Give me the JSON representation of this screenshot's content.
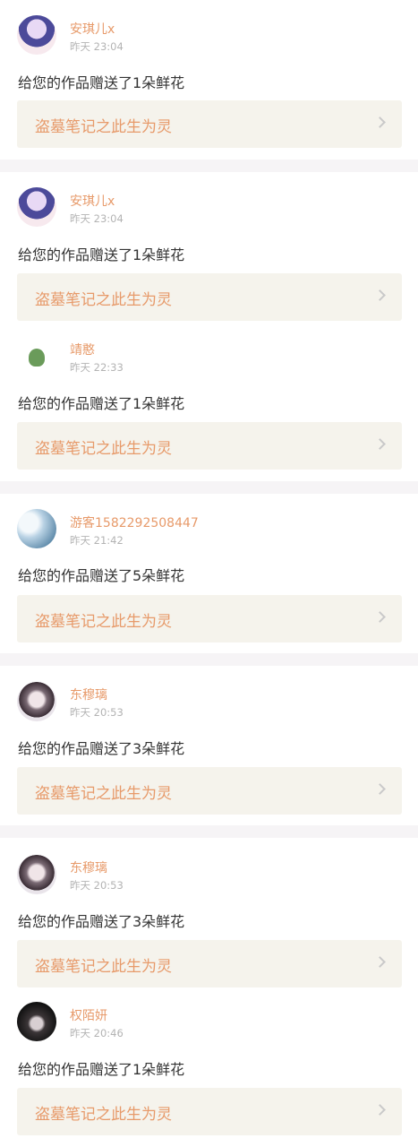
{
  "items": [
    {
      "user": "安琪儿x",
      "time": "昨天 23:04",
      "message": "给您的作品赠送了1朵鲜花",
      "work": "盗墓笔记之此生为灵",
      "avatar_icon": "anime-girl-avatar"
    },
    {
      "user": "安琪儿x",
      "time": "昨天 23:04",
      "message": "给您的作品赠送了1朵鲜花",
      "work": "盗墓笔记之此生为灵",
      "avatar_icon": "anime-girl-avatar"
    },
    {
      "user": "靖憨",
      "time": "昨天 22:33",
      "message": "给您的作品赠送了1朵鲜花",
      "work": "盗墓笔记之此生为灵",
      "avatar_icon": "green-blob-avatar"
    },
    {
      "user": "游客1582292508447",
      "time": "昨天 21:42",
      "message": "给您的作品赠送了5朵鲜花",
      "work": "盗墓笔记之此生为灵",
      "avatar_icon": "sky-avatar"
    },
    {
      "user": "东穆璃",
      "time": "昨天 20:53",
      "message": "给您的作品赠送了3朵鲜花",
      "work": "盗墓笔记之此生为灵",
      "avatar_icon": "girl-portrait-avatar"
    },
    {
      "user": "东穆璃",
      "time": "昨天 20:53",
      "message": "给您的作品赠送了3朵鲜花",
      "work": "盗墓笔记之此生为灵",
      "avatar_icon": "girl-portrait-avatar"
    },
    {
      "user": "权陌妍",
      "time": "昨天 20:46",
      "message": "给您的作品赠送了1朵鲜花",
      "work": "盗墓笔记之此生为灵",
      "avatar_icon": "dark-portrait-avatar"
    }
  ],
  "colors": {
    "accent": "#e79a6a",
    "card_bg": "#f5f3ec",
    "separator": "#f6f4f6",
    "text": "#333333",
    "muted": "#b3b3b3"
  }
}
